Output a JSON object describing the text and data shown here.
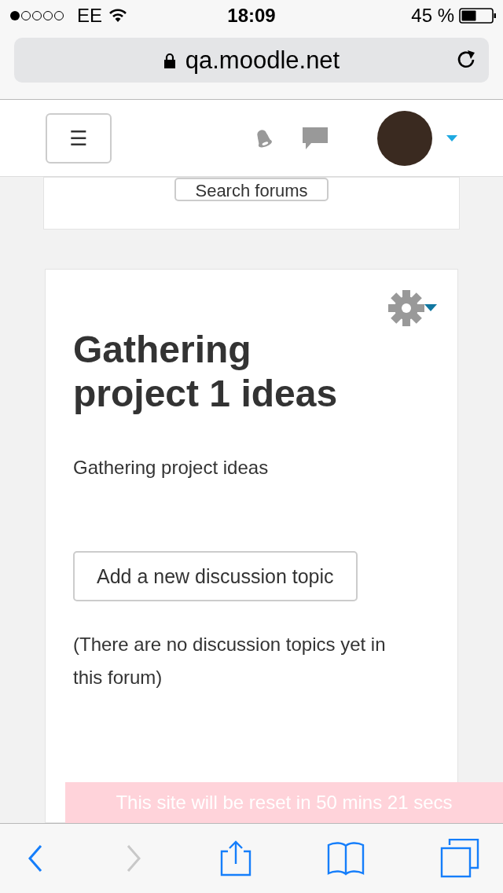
{
  "status_bar": {
    "carrier": "EE",
    "time": "18:09",
    "battery": "45 %"
  },
  "address_bar": {
    "url": "qa.moodle.net"
  },
  "header": {
    "menu_button": "☰"
  },
  "search_card": {
    "button": "Search forums"
  },
  "forum": {
    "title": "Gathering project 1 ideas",
    "description": "Gathering project ideas",
    "add_button": "Add a new discussion topic",
    "empty_message": "(There are no discussion topics yet in this forum)"
  },
  "reset_notice": "This site will be reset in 50 mins 21 secs",
  "toolbar": [
    {
      "kind": "back",
      "disabled": false
    },
    {
      "kind": "forward",
      "disabled": true
    },
    {
      "kind": "share",
      "disabled": false
    },
    {
      "kind": "bookmarks",
      "disabled": false
    },
    {
      "kind": "tabs",
      "disabled": false
    }
  ]
}
